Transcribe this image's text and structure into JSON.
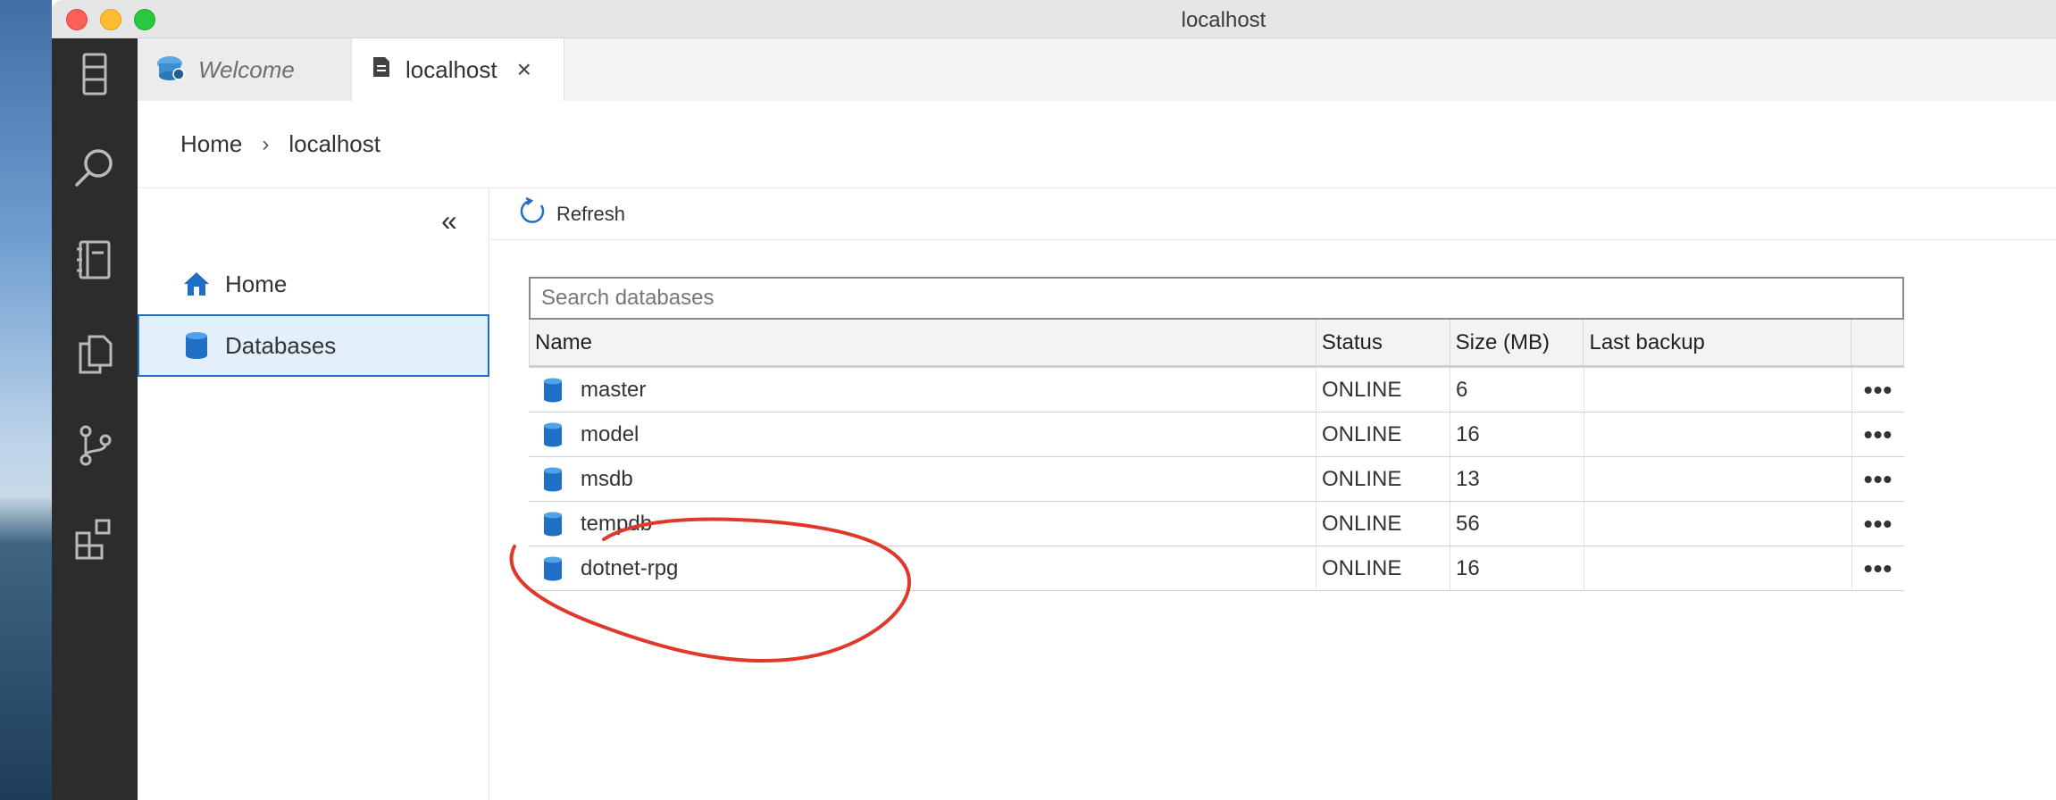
{
  "window": {
    "title": "localhost"
  },
  "tabs": [
    {
      "label": "Welcome",
      "icon": "welcome-icon"
    },
    {
      "label": "localhost",
      "icon": "server-dashboard-icon",
      "close": "×"
    }
  ],
  "breadcrumb": {
    "home": "Home",
    "separator": "›",
    "current": "localhost"
  },
  "nav": {
    "collapse": "«",
    "items": [
      {
        "label": "Home",
        "icon": "home-icon"
      },
      {
        "label": "Databases",
        "icon": "database-icon"
      }
    ]
  },
  "toolbar": {
    "refresh_label": "Refresh"
  },
  "search": {
    "placeholder": "Search databases",
    "value": ""
  },
  "table": {
    "columns": [
      "Name",
      "Status",
      "Size (MB)",
      "Last backup",
      ""
    ],
    "rows": [
      {
        "name": "master",
        "status": "ONLINE",
        "size": "6",
        "backup": "",
        "more": "•••"
      },
      {
        "name": "model",
        "status": "ONLINE",
        "size": "16",
        "backup": "",
        "more": "•••"
      },
      {
        "name": "msdb",
        "status": "ONLINE",
        "size": "13",
        "backup": "",
        "more": "•••"
      },
      {
        "name": "tempdb",
        "status": "ONLINE",
        "size": "56",
        "backup": "",
        "more": "•••"
      },
      {
        "name": "dotnet-rpg",
        "status": "ONLINE",
        "size": "16",
        "backup": "",
        "more": "•••"
      }
    ]
  },
  "colors": {
    "accent": "#1f6fc5",
    "selection_bg": "#e3effb",
    "annotation": "#e0392b",
    "activity_bar": "#2c2c2c"
  }
}
